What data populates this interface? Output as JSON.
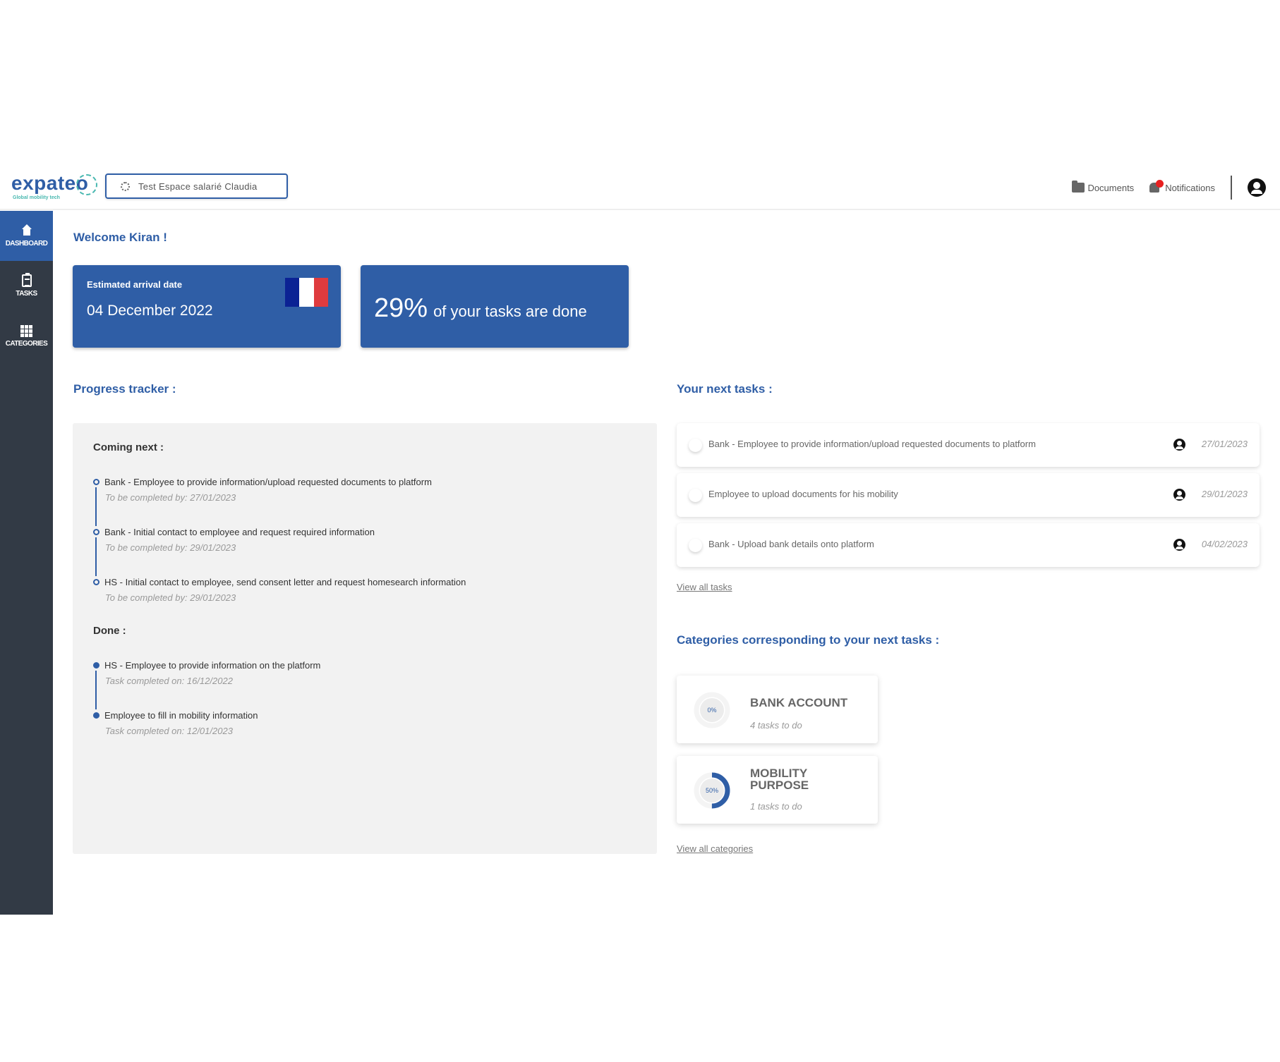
{
  "header": {
    "logo_text": "expateo",
    "logo_tagline": "Global mobility tech",
    "space_button": "Test Espace salarié Claudia",
    "documents_label": "Documents",
    "notifications_label": "Notifications",
    "notification_dot_color": "#e82020"
  },
  "sidebar": {
    "items": [
      {
        "label": "DASHBOARD",
        "icon": "home-icon",
        "active": true
      },
      {
        "label": "TASKS",
        "icon": "clipboard-icon",
        "active": false
      },
      {
        "label": "CATEGORIES",
        "icon": "grid-icon",
        "active": false
      }
    ]
  },
  "main": {
    "welcome": "Welcome Kiran !",
    "arrival_card": {
      "label": "Estimated arrival date",
      "date": "04 December 2022",
      "flag": "France",
      "flag_colors": [
        "#0b2294",
        "#ffffff",
        "#df3b3e"
      ]
    },
    "progress_card": {
      "percent": "29%",
      "text": "of your tasks are done"
    },
    "progress_tracker": {
      "title": "Progress tracker :",
      "coming_next_label": "Coming next :",
      "coming_next": [
        {
          "title": "Bank - Employee to provide information/upload requested documents to platform",
          "sub": "To be completed by: 27/01/2023"
        },
        {
          "title": "Bank - Initial contact to employee and request required information",
          "sub": "To be completed by: 29/01/2023"
        },
        {
          "title": "HS - Initial contact to employee, send consent letter and request homesearch information",
          "sub": "To be completed by: 29/01/2023"
        }
      ],
      "done_label": "Done :",
      "done": [
        {
          "title": "HS - Employee to provide information on the platform",
          "sub": "Task completed on: 16/12/2022"
        },
        {
          "title": "Employee to fill in mobility information",
          "sub": "Task completed on: 12/01/2023"
        }
      ]
    },
    "next_tasks": {
      "title": "Your next tasks :",
      "items": [
        {
          "text": "Bank - Employee to provide information/upload requested documents to platform",
          "date": "27/01/2023"
        },
        {
          "text": "Employee to upload documents for his mobility",
          "date": "29/01/2023"
        },
        {
          "text": "Bank - Upload bank details onto platform",
          "date": "04/02/2023"
        }
      ],
      "view_all": "View all tasks"
    },
    "categories": {
      "title": "Categories corresponding to your next tasks :",
      "items": [
        {
          "name": "BANK ACCOUNT",
          "percent_label": "0%",
          "progress": 0,
          "sub": "4 tasks to do"
        },
        {
          "name": "MOBILITY PURPOSE",
          "percent_label": "50%",
          "progress": 0.5,
          "sub": "1 tasks to do"
        }
      ],
      "view_all": "View all categories"
    }
  },
  "colors": {
    "brand": "#2f5ea6",
    "sidebar_bg": "#323a45",
    "panel_bg": "#f2f2f2"
  }
}
